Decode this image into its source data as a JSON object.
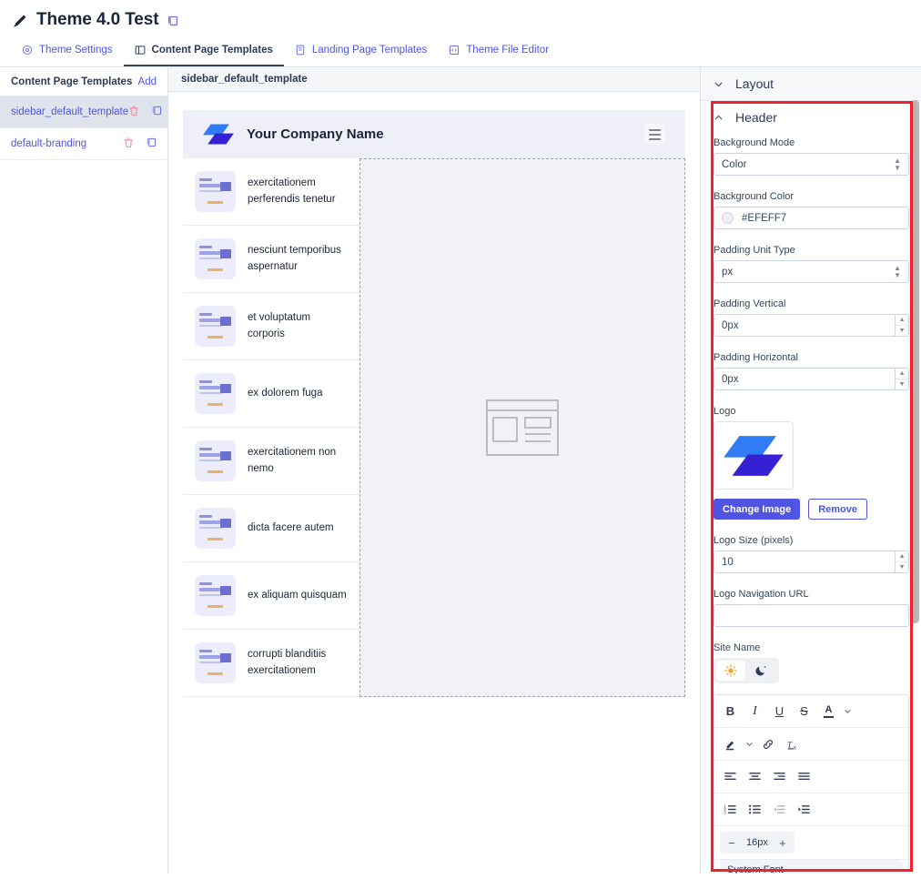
{
  "titlebar": {
    "edit_icon": "pencil-icon",
    "title": "Theme 4.0 Test",
    "copy_icon": "copy-icon"
  },
  "tabs": [
    {
      "label": "Theme Settings",
      "icon": "settings-gear-icon",
      "active": false
    },
    {
      "label": "Content Page Templates",
      "icon": "layout-sidebar-icon",
      "active": true
    },
    {
      "label": "Landing Page Templates",
      "icon": "document-icon",
      "active": false
    },
    {
      "label": "Theme File Editor",
      "icon": "code-file-icon",
      "active": false
    }
  ],
  "template_list": {
    "title": "Content Page Templates",
    "add_label": "Add",
    "items": [
      {
        "name": "sidebar_default_template",
        "selected": true,
        "delete_icon": "trash-icon",
        "clone_icon": "copy-icon"
      },
      {
        "name": "default-branding",
        "selected": false,
        "delete_icon": "trash-icon",
        "clone_icon": "copy-icon"
      }
    ]
  },
  "preview": {
    "header_label": "sidebar_default_template",
    "site": {
      "brand_name": "Your Company Name",
      "logo_icon": "company-logo",
      "menu_icon": "hamburger-menu-icon",
      "header_bg": "#EFEFF7",
      "nav_items": [
        "exercitationem perferendis tenetur",
        "nesciunt temporibus aspernatur",
        "et voluptatum corporis",
        "ex dolorem fuga",
        "exercitationem non nemo",
        "dicta facere autem",
        "ex aliquam quisquam",
        "corrupti blanditiis exercitationem"
      ],
      "main_placeholder_icon": "page-layout-placeholder-icon"
    }
  },
  "settings": {
    "sections": [
      {
        "id": "layout",
        "label": "Layout",
        "expanded": false,
        "chevron": "chevron-down-icon"
      },
      {
        "id": "header",
        "label": "Header",
        "expanded": true,
        "chevron": "chevron-up-icon"
      }
    ],
    "header": {
      "background_mode": {
        "label": "Background Mode",
        "value": "Color"
      },
      "background_color": {
        "label": "Background Color",
        "value": "#EFEFF7",
        "swatch": "#EFEFF7"
      },
      "padding_unit_type": {
        "label": "Padding Unit Type",
        "value": "px"
      },
      "padding_vertical": {
        "label": "Padding Vertical",
        "value": "0px"
      },
      "padding_horizontal": {
        "label": "Padding Horizontal",
        "value": "0px"
      },
      "logo": {
        "label": "Logo",
        "change_label": "Change Image",
        "remove_label": "Remove",
        "image_icon": "company-logo"
      },
      "logo_size": {
        "label": "Logo Size (pixels)",
        "value": "10"
      },
      "logo_nav_url": {
        "label": "Logo Navigation URL",
        "value": "",
        "placeholder": ""
      },
      "site_name": {
        "label": "Site Name",
        "modes": [
          {
            "id": "light",
            "icon": "sun-icon",
            "active": true
          },
          {
            "id": "dark",
            "icon": "moon-icon",
            "active": false
          }
        ],
        "toolbar": {
          "row1": [
            {
              "name": "bold-icon",
              "glyph": "B"
            },
            {
              "name": "italic-icon",
              "glyph": "I"
            },
            {
              "name": "underline-icon",
              "glyph": "U"
            },
            {
              "name": "strikethrough-icon",
              "glyph": "S"
            },
            {
              "name": "text-color-icon",
              "glyph": "A"
            },
            {
              "name": "chevron-down-icon",
              "glyph": "⌄"
            }
          ],
          "row2": [
            {
              "name": "highlight-color-icon",
              "glyph": ""
            },
            {
              "name": "chevron-down-icon",
              "glyph": "⌄"
            },
            {
              "name": "link-icon",
              "glyph": ""
            },
            {
              "name": "clear-formatting-icon",
              "glyph": ""
            }
          ],
          "row3": [
            {
              "name": "align-left-icon",
              "glyph": ""
            },
            {
              "name": "align-center-icon",
              "glyph": ""
            },
            {
              "name": "align-right-icon",
              "glyph": ""
            },
            {
              "name": "align-justify-icon",
              "glyph": ""
            }
          ],
          "row4": [
            {
              "name": "ordered-list-icon",
              "glyph": ""
            },
            {
              "name": "bullet-list-icon",
              "glyph": ""
            },
            {
              "name": "outdent-icon",
              "glyph": ""
            },
            {
              "name": "indent-icon",
              "glyph": ""
            }
          ],
          "font_size": {
            "decrease": "−",
            "value": "16px",
            "increase": "+"
          },
          "font_family": {
            "value": "System Font"
          }
        }
      }
    }
  },
  "scrollbar": {
    "name": "settings-scrollbar"
  },
  "highlight": {
    "color": "#F4202A"
  }
}
